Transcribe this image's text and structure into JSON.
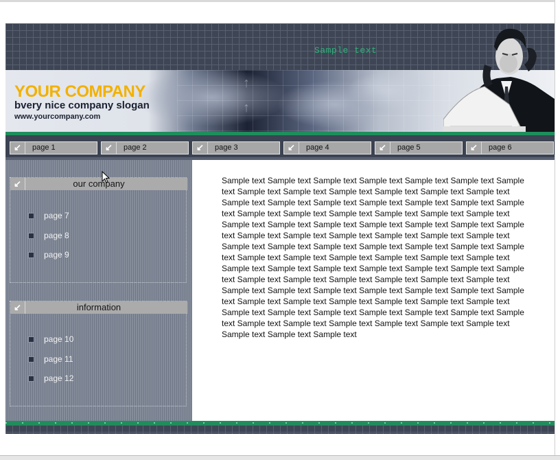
{
  "header": {
    "sample_text": "Sample text",
    "company_name": "YOUR COMPANY",
    "slogan": "bvery nice company slogan",
    "website": "www.yourcompany.com"
  },
  "topnav": {
    "tabs": [
      {
        "label": "page 1"
      },
      {
        "label": "page 2"
      },
      {
        "label": "page 3"
      },
      {
        "label": "page 4"
      },
      {
        "label": "page 5"
      },
      {
        "label": "page 6"
      }
    ]
  },
  "sidebar": {
    "boxes": [
      {
        "title": "our company",
        "items": [
          "page 7",
          "page 8",
          "page 9"
        ]
      },
      {
        "title": "information",
        "items": [
          "page 10",
          "page 11",
          "page 12"
        ]
      }
    ]
  },
  "content": {
    "body": "Sample text Sample text Sample text Sample text Sample text Sample text Sample text Sample text Sample text Sample text Sample text Sample text Sample text Sample text Sample text Sample text Sample text Sample text Sample text Sample text Sample text Sample text Sample text Sample text Sample text Sample text Sample text Sample text Sample text Sample text Sample text Sample text Sample text Sample text Sample text Sample text Sample text Sample text Sample text Sample text Sample text Sample text Sample text Sample text Sample text Sample text Sample text Sample text Sample text Sample text Sample text Sample text Sample text Sample text Sample text Sample text Sample text Sample text Sample text Sample text Sample text Sample text Sample text Sample text Sample text Sample text Sample text Sample text Sample text Sample text Sample text Sample text Sample text Sample text Sample text Sample text Sample text Sample text Sample text Sample text Sample text Sample text Sample text Sample text Sample text Sample text Sample text Sample text Sample text Sample text Sample text Sample text Sample text Sample text"
  },
  "colors": {
    "company_name": "#f2b100",
    "accent_green": "#1e8f5c",
    "header_dark": "#3e4554",
    "sample_text_green": "#2fb07a"
  },
  "icons": {
    "tab_icon": "arrow-down-left-icon",
    "box_icon": "arrow-down-left-icon",
    "bullet": "square-bullet-icon"
  }
}
